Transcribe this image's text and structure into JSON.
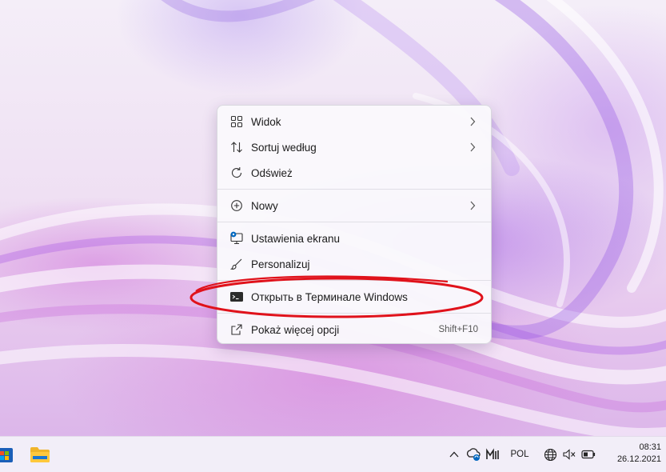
{
  "context_menu": {
    "items": [
      {
        "label": "Widok",
        "icon": "grid-icon",
        "has_submenu": true
      },
      {
        "label": "Sortuj według",
        "icon": "sort-icon",
        "has_submenu": true
      },
      {
        "label": "Odśwież",
        "icon": "refresh-icon",
        "has_submenu": false
      },
      {
        "label": "Nowy",
        "icon": "add-circle-icon",
        "has_submenu": true
      },
      {
        "label": "Ustawienia ekranu",
        "icon": "display-settings-icon",
        "has_submenu": false
      },
      {
        "label": "Personalizuj",
        "icon": "brush-icon",
        "has_submenu": false
      },
      {
        "label": "Открыть в Терминале Windows",
        "icon": "terminal-icon",
        "has_submenu": false
      },
      {
        "label": "Pokaż więcej opcji",
        "icon": "open-external-icon",
        "shortcut": "Shift+F10",
        "has_submenu": false
      }
    ]
  },
  "annotation": {
    "target": "Открыть в Терминале Windows",
    "color": "#e0121b"
  },
  "taskbar": {
    "pinned": [
      "store-icon",
      "file-explorer-icon"
    ],
    "tray": {
      "language": "POL",
      "time": "08:31",
      "date": "26.12.2021",
      "icons": [
        "chevron-up-icon",
        "onedrive-sync-icon",
        "meet-now-icon",
        "globe-icon",
        "volume-muted-icon",
        "battery-icon"
      ]
    }
  },
  "colors": {
    "accent": "#0067c0",
    "menu_bg": "#faf9fc",
    "highlight": "#e0121b"
  }
}
